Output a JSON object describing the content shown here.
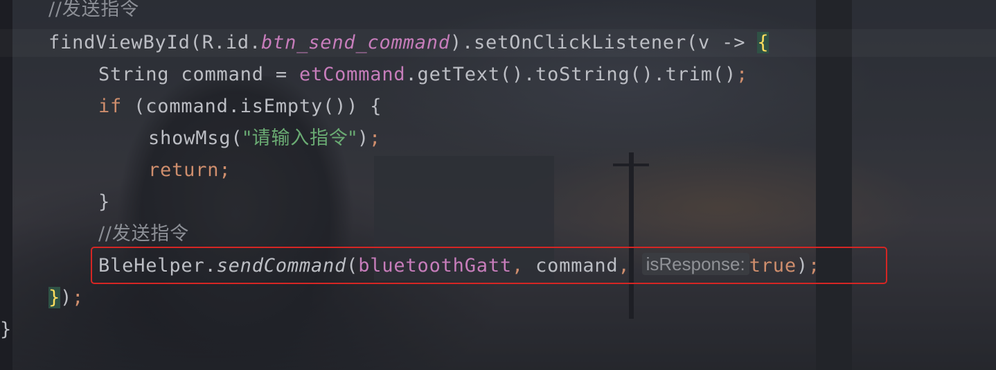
{
  "editor": {
    "line0": {
      "comment": "//发送指令"
    },
    "line1": {
      "a": "findViewById(R.id.",
      "field": "btn_send_command",
      "b": ").setOnClickListener(v -> ",
      "brace": "{"
    },
    "line2": {
      "a": "String command = ",
      "field": "etCommand",
      "b": ".getText().toString().trim()",
      "semi": ";"
    },
    "line3": {
      "kw": "if",
      "rest": " (command.isEmpty()) {"
    },
    "line4": {
      "a": "showMsg(",
      "str": "\"请输入指令\"",
      "b": ")",
      "semi": ";"
    },
    "line5": {
      "kw": "return",
      "semi": ";"
    },
    "line6": {
      "text": "}"
    },
    "line7": {
      "comment": "//发送指令"
    },
    "line8": {
      "a": "BleHelper.",
      "method": "sendCommand",
      "b": "(",
      "field": "bluetoothGatt",
      "c1": ", ",
      "c2": "command",
      "c3": ", ",
      "hint": "isResponse:",
      "kw": "true",
      "d": ")",
      "semi": ";"
    },
    "line9": {
      "brace": "}",
      "rest": ")",
      "semi": ";"
    },
    "line10": {
      "text": "}"
    }
  },
  "colors": {
    "keyword": "#cf8e6d",
    "field": "#c77dbb",
    "string": "#6aab73",
    "comment": "#8c8f96",
    "default": "#bcbec4",
    "highlight_border": "#d62624"
  }
}
